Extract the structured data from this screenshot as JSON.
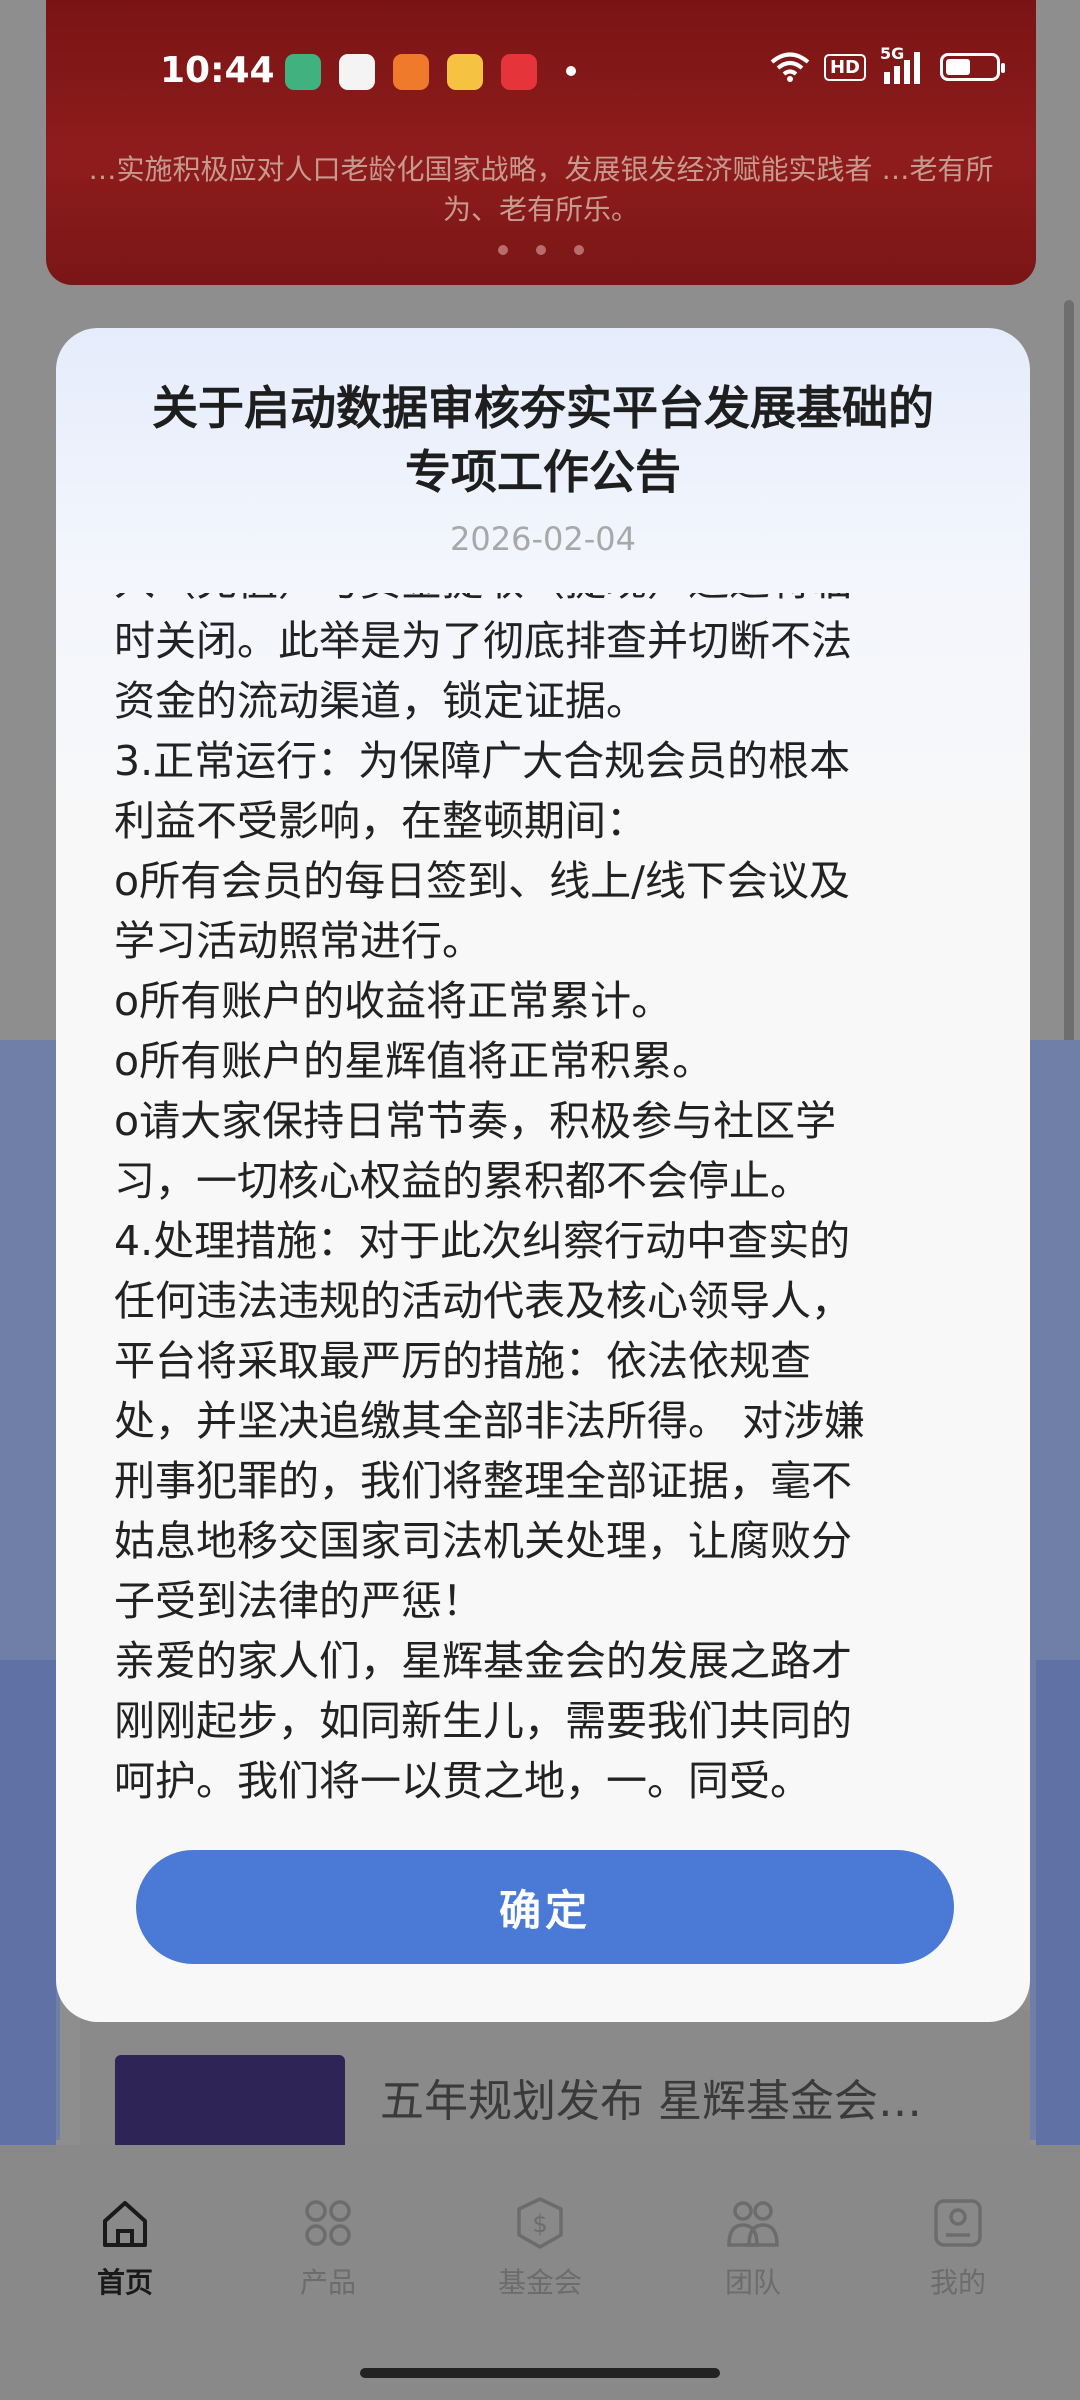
{
  "status_bar": {
    "time": "10:44",
    "hd_label": "HD",
    "network_label": "5G"
  },
  "background": {
    "banner_text": "…实施积极应对人口老龄化国家战略，发展银发经济赋能实践者 …老有所为、老有所乐。",
    "news_title": "五年规划发布 星辉基金会…"
  },
  "modal": {
    "title_line1": "关于启动数据审核夯实平台发展基础的",
    "title_line2": "专项工作公告",
    "date": "2026-02-04",
    "content_lines": [
      "入（充值）与资金提取（提现）通道将临",
      "时关闭。此举是为了彻底排查并切断不法",
      "资金的流动渠道，锁定证据。",
      "3.正常运行：为保障广大合规会员的根本",
      "利益不受影响，在整顿期间：",
      "o所有会员的每日签到、线上/线下会议及",
      "学习活动照常进行。",
      "o所有账户的收益将正常累计。",
      "o所有账户的星辉值将正常积累。",
      "o请大家保持日常节奏，积极参与社区学",
      "习，一切核心权益的累积都不会停止。",
      "4.处理措施：对于此次纠察行动中查实的",
      "任何违法违规的活动代表及核心领导人，",
      "平台将采取最严厉的措施：依法依规查",
      "处，并坚决追缴其全部非法所得。 对涉嫌",
      "刑事犯罪的，我们将整理全部证据，毫不",
      "姑息地移交国家司法机关处理，让腐败分",
      "子受到法律的严惩！",
      "亲爱的家人们，星辉基金会的发展之路才",
      "刚刚起步，如同新生儿，需要我们共同的",
      "呵护。我们将一以贯之地，一。同受。"
    ],
    "confirm_label": "确定"
  },
  "bottom_nav": {
    "items": [
      {
        "label": "首页",
        "icon": "home-icon",
        "active": true
      },
      {
        "label": "产品",
        "icon": "grid-icon",
        "active": false
      },
      {
        "label": "基金会",
        "icon": "dollar-shield-icon",
        "active": false
      },
      {
        "label": "团队",
        "icon": "team-icon",
        "active": false
      },
      {
        "label": "我的",
        "icon": "profile-icon",
        "active": false
      }
    ]
  },
  "colors": {
    "accent": "#4a79d6",
    "overlay": "#8e8e8e",
    "modal_bg": "#f8f8f8"
  }
}
